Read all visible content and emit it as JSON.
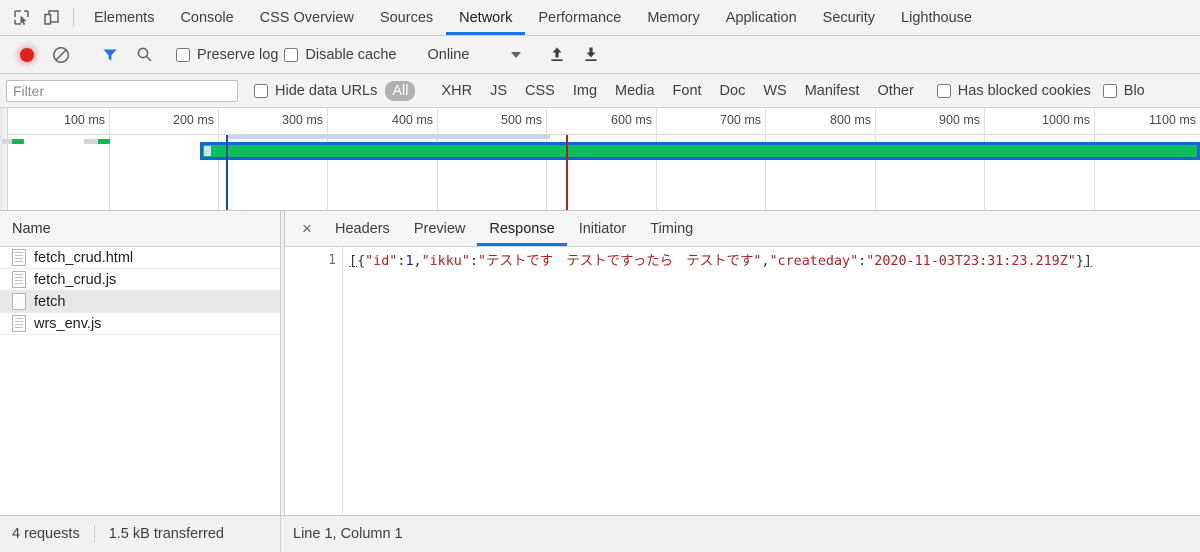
{
  "devtools": {
    "icons": {
      "inspect": "inspect-element-icon",
      "device": "device-toolbar-icon"
    },
    "panels": [
      {
        "label": "Elements",
        "active": false
      },
      {
        "label": "Console",
        "active": false
      },
      {
        "label": "CSS Overview",
        "active": false
      },
      {
        "label": "Sources",
        "active": false
      },
      {
        "label": "Network",
        "active": true
      },
      {
        "label": "Performance",
        "active": false
      },
      {
        "label": "Memory",
        "active": false
      },
      {
        "label": "Application",
        "active": false
      },
      {
        "label": "Security",
        "active": false
      },
      {
        "label": "Lighthouse",
        "active": false
      }
    ]
  },
  "network_toolbar": {
    "record_label": "record-button",
    "clear_label": "clear-button",
    "filter_toggle_label": "filter-icon",
    "search_label": "search-icon",
    "preserve_log": {
      "label": "Preserve log",
      "checked": false
    },
    "disable_cache": {
      "label": "Disable cache",
      "checked": false
    },
    "throttling": {
      "value": "Online"
    },
    "import_label": "import-har-icon",
    "export_label": "export-har-icon"
  },
  "filter_bar": {
    "filter_placeholder": "Filter",
    "filter_value": "",
    "hide_data_urls": {
      "label": "Hide data URLs",
      "checked": false
    },
    "types": [
      {
        "label": "All",
        "selected": true
      },
      {
        "label": "XHR",
        "selected": false
      },
      {
        "label": "JS",
        "selected": false
      },
      {
        "label": "CSS",
        "selected": false
      },
      {
        "label": "Img",
        "selected": false
      },
      {
        "label": "Media",
        "selected": false
      },
      {
        "label": "Font",
        "selected": false
      },
      {
        "label": "Doc",
        "selected": false
      },
      {
        "label": "WS",
        "selected": false
      },
      {
        "label": "Manifest",
        "selected": false
      },
      {
        "label": "Other",
        "selected": false
      }
    ],
    "has_blocked_cookies": {
      "label": "Has blocked cookies",
      "checked": false
    },
    "blocked_requests": {
      "label": "Blo",
      "checked": false
    }
  },
  "overview": {
    "ticks": [
      "100 ms",
      "200 ms",
      "300 ms",
      "400 ms",
      "500 ms",
      "600 ms",
      "700 ms",
      "800 ms",
      "900 ms",
      "1000 ms",
      "1100 ms"
    ],
    "colors": {
      "download": "#0fbf5f",
      "waiting": "#d5d5d5",
      "selection_border": "#1568d0",
      "dom_content_loaded": "#1a4f9c",
      "load": "#a52525"
    }
  },
  "requests": {
    "column_header": "Name",
    "rows": [
      {
        "name": "fetch_crud.html",
        "icon": "document-icon",
        "selected": false
      },
      {
        "name": "fetch_crud.js",
        "icon": "document-icon",
        "selected": false
      },
      {
        "name": "fetch",
        "icon": "blank-document-icon",
        "selected": true
      },
      {
        "name": "wrs_env.js",
        "icon": "document-icon",
        "selected": false
      }
    ]
  },
  "detail": {
    "close_label": "×",
    "tabs": [
      {
        "label": "Headers",
        "active": false
      },
      {
        "label": "Preview",
        "active": false
      },
      {
        "label": "Response",
        "active": true
      },
      {
        "label": "Initiator",
        "active": false
      },
      {
        "label": "Timing",
        "active": false
      }
    ],
    "response": {
      "line_number": "1",
      "tokens": [
        {
          "text": "[",
          "kind": "bracket"
        },
        {
          "text": "{",
          "kind": "punct"
        },
        {
          "text": "\"id\"",
          "kind": "key"
        },
        {
          "text": ":",
          "kind": "punct"
        },
        {
          "text": "1",
          "kind": "num"
        },
        {
          "text": ",",
          "kind": "punct"
        },
        {
          "text": "\"ikku\"",
          "kind": "key"
        },
        {
          "text": ":",
          "kind": "punct"
        },
        {
          "text": "\"テストです　テストですったら　テストです\"",
          "kind": "str"
        },
        {
          "text": ",",
          "kind": "punct"
        },
        {
          "text": "\"createday\"",
          "kind": "key"
        },
        {
          "text": ":",
          "kind": "punct"
        },
        {
          "text": "\"2020-11-03T23:31:23.219Z\"",
          "kind": "str"
        },
        {
          "text": "}",
          "kind": "punct"
        },
        {
          "text": "]",
          "kind": "bracket"
        }
      ]
    }
  },
  "status_bar": {
    "requests": "4 requests",
    "transferred": "1.5 kB transferred",
    "cursor": "Line 1, Column 1"
  }
}
